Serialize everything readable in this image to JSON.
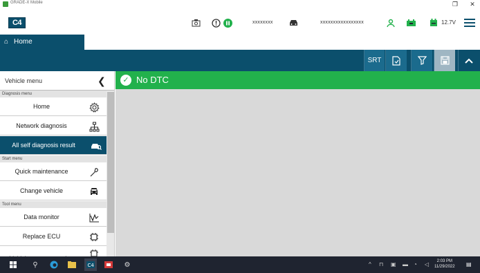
{
  "window": {
    "title": "GRADE-X Mobile",
    "restore_glyph": "❐",
    "close_glyph": "✕"
  },
  "header": {
    "logo_text": "C4",
    "masked_id_1": "xxxxxxxx",
    "masked_id_2": "xxxxxxxxxxxxxxxxx",
    "voltage": "12.7V",
    "icons": [
      "camera-icon",
      "alert-icon",
      "pause-icon",
      "car-icon",
      "person-wave-icon",
      "battery-icon",
      "calendar-battery-icon",
      "menu-icon"
    ]
  },
  "tab": {
    "home_label": "Home"
  },
  "toolbar": {
    "srt_label": "SRT",
    "icons": [
      "document-icon",
      "filter-icon",
      "save-icon",
      "collapse-up-icon"
    ]
  },
  "sidebar": {
    "title": "Vehicle menu",
    "sections": [
      {
        "label": "Diagnosis menu"
      },
      {
        "label": "Start menu"
      },
      {
        "label": "Tool menu"
      }
    ],
    "items": [
      {
        "label": "Home",
        "icon": "gear-icon"
      },
      {
        "label": "Network diagnosis",
        "icon": "network-icon"
      },
      {
        "label": "All self diagnosis result",
        "icon": "car-search-icon"
      },
      {
        "label": "Quick maintenance",
        "icon": "wrench-icon"
      },
      {
        "label": "Change vehicle",
        "icon": "car-front-icon"
      },
      {
        "label": "Data monitor",
        "icon": "monitor-graph-icon"
      },
      {
        "label": "Replace ECU",
        "icon": "chip-icon"
      },
      {
        "label": "Vehicle reprogramming",
        "icon": "chip-icon"
      }
    ]
  },
  "main": {
    "status_text": "No DTC",
    "status_color": "#22b14c"
  },
  "taskbar": {
    "time": "2:03 PM",
    "date": "11/29/2022"
  }
}
